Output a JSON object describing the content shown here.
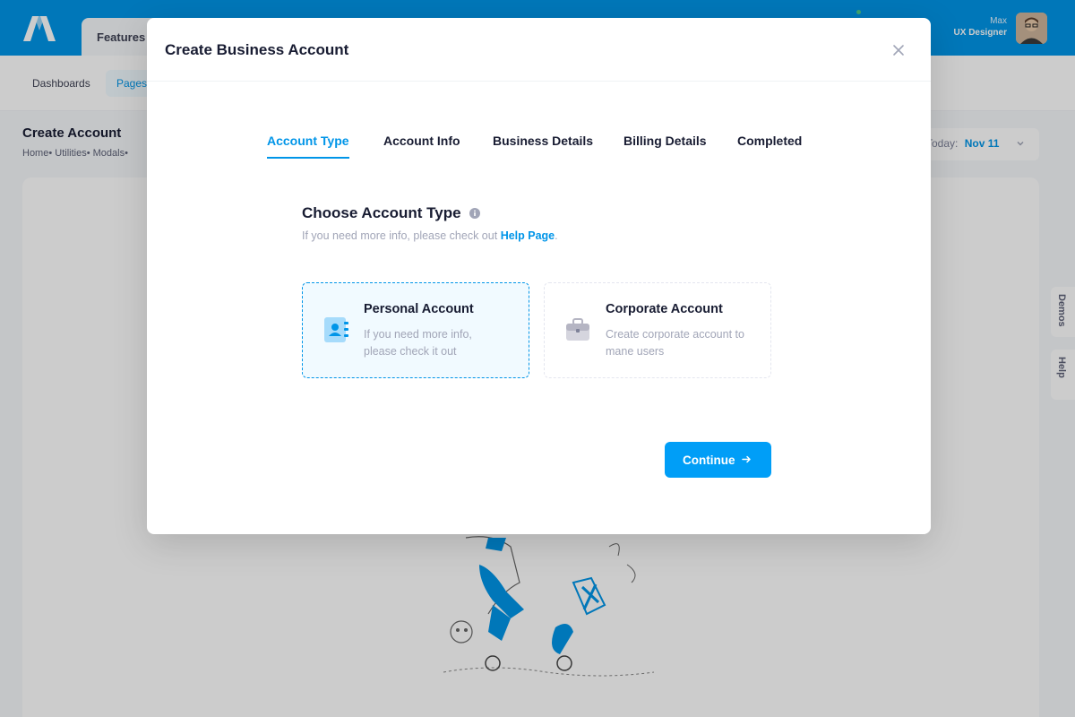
{
  "app": {
    "top_tab": "Features",
    "user": {
      "name": "Max",
      "role": "UX Designer"
    }
  },
  "subnav": {
    "items": [
      "Dashboards",
      "Pages"
    ]
  },
  "page": {
    "title": "Create Account",
    "breadcrumb": [
      "Home",
      "Utilities",
      "Modals"
    ],
    "today_label": "Today:",
    "today_date": "Nov 11"
  },
  "side_tabs": [
    "Demos",
    "Help"
  ],
  "modal": {
    "title": "Create Business Account",
    "steps": [
      "Account Type",
      "Account Info",
      "Business Details",
      "Billing Details",
      "Completed"
    ],
    "active_step": 0,
    "section_title": "Choose Account Type",
    "section_sub_prefix": "If you need more info, please check out",
    "help_link": "Help Page",
    "section_sub_suffix": ".",
    "accounts": [
      {
        "name": "Personal Account",
        "description": "If you need more info, please check it out",
        "icon": "address-book-icon",
        "selected": true
      },
      {
        "name": "Corporate Account",
        "description": "Create corporate account to mane users",
        "icon": "briefcase-icon",
        "selected": false
      }
    ],
    "continue_label": "Continue"
  },
  "colors": {
    "brand": "#0095e8",
    "primary_button": "#009ef7",
    "selected_card_bg": "#f1faff",
    "muted_text": "#a1a5b7"
  }
}
